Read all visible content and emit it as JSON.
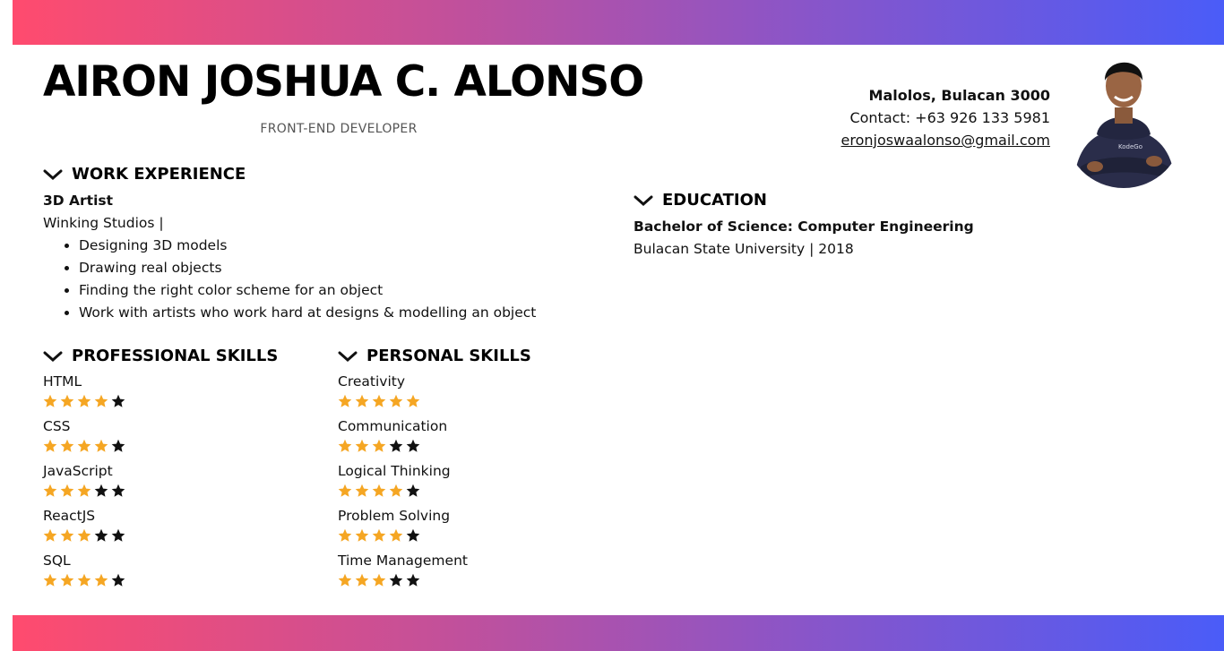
{
  "header": {
    "name": "AIRON JOSHUA C. ALONSO",
    "role": "FRONT-END DEVELOPER"
  },
  "contact": {
    "address": "Malolos, Bulacan 3000",
    "phone": "Contact: +63 926 133 5981",
    "email": "eronjoswaalonso@gmail.com"
  },
  "avatar": {
    "logo_text": "KodeGo"
  },
  "work": {
    "title": "WORK EXPERIENCE",
    "job_title": "3D Artist",
    "company": "Winking Studios |",
    "duties": [
      "Designing 3D models",
      "Drawing real objects",
      "Finding the right color scheme for an object",
      "Work with artists who work hard at designs & modelling an object"
    ]
  },
  "education": {
    "title": "EDUCATION",
    "degree": "Bachelor of Science: Computer Engineering",
    "school": "Bulacan State University | 2018"
  },
  "professional_skills": {
    "title": "PROFESSIONAL SKILLS",
    "items": [
      {
        "name": "HTML",
        "rating": 4,
        "max": 5
      },
      {
        "name": "CSS",
        "rating": 4,
        "max": 5
      },
      {
        "name": "JavaScript",
        "rating": 3,
        "max": 5
      },
      {
        "name": "ReactJS",
        "rating": 3,
        "max": 5
      },
      {
        "name": "SQL",
        "rating": 4,
        "max": 5
      }
    ]
  },
  "personal_skills": {
    "title": "PERSONAL SKILLS",
    "items": [
      {
        "name": "Creativity",
        "rating": 5,
        "max": 5
      },
      {
        "name": "Communication",
        "rating": 3,
        "max": 5
      },
      {
        "name": "Logical Thinking",
        "rating": 4,
        "max": 5
      },
      {
        "name": "Problem Solving",
        "rating": 4,
        "max": 5
      },
      {
        "name": "Time Management",
        "rating": 3,
        "max": 5
      }
    ]
  },
  "colors": {
    "star_filled": "#f5a623",
    "star_empty": "#111111",
    "gradient_start": "#ff4b6e",
    "gradient_end": "#4a5cf8"
  }
}
